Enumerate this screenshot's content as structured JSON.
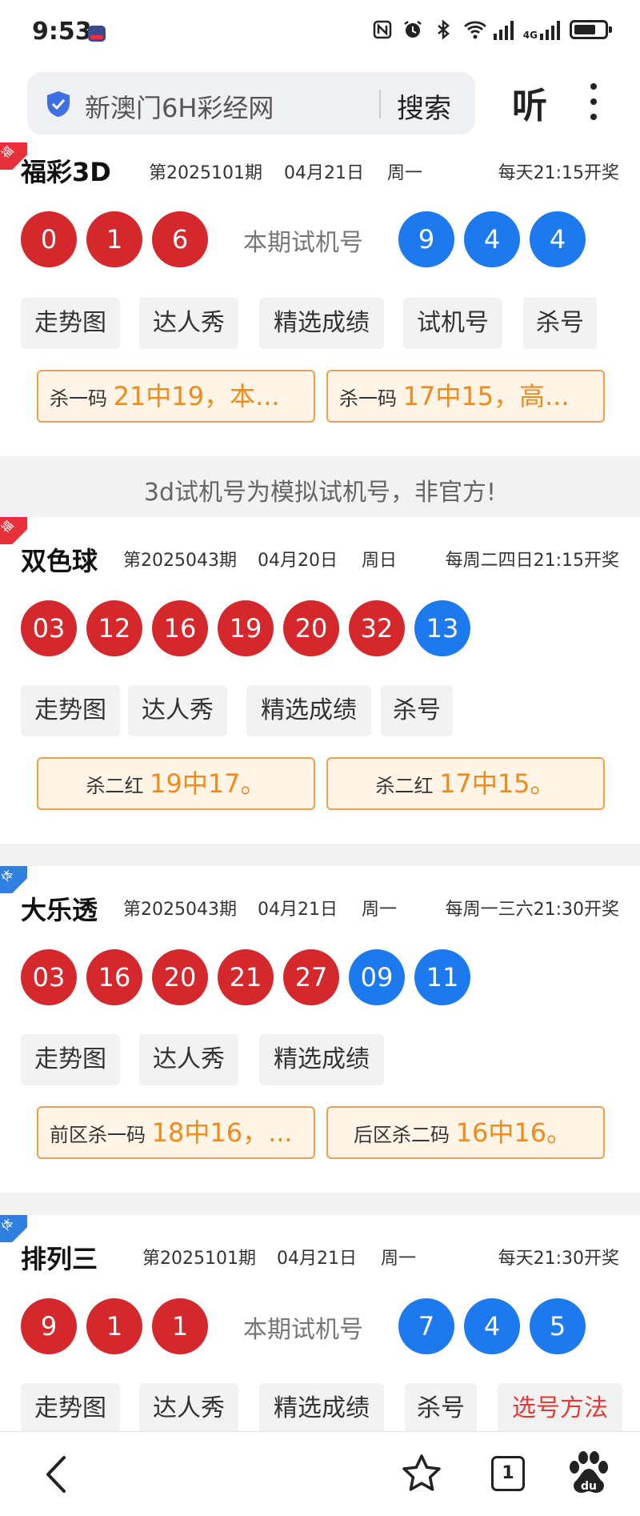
{
  "status": {
    "time": "9:53",
    "network": "4G"
  },
  "search": {
    "query": "新澳门6H彩经网",
    "button": "搜索",
    "listen": "听"
  },
  "cards": [
    {
      "tag": "福",
      "title": "福彩3D",
      "period": "第2025101期",
      "date": "04月21日",
      "weekday": "周一",
      "schedule": "每天21:15开奖",
      "balls": [
        "0",
        "1",
        "6"
      ],
      "trial_label": "本期试机号",
      "trial_balls": [
        "9",
        "4",
        "4"
      ],
      "tabs": [
        "走势图",
        "达人秀",
        "精选成绩",
        "试机号",
        "杀号"
      ],
      "kills": [
        {
          "label": "杀一码",
          "value": "21中19，本..."
        },
        {
          "label": "杀一码",
          "value": "17中15，高..."
        }
      ]
    },
    {
      "tag": "福",
      "title": "双色球",
      "period": "第2025043期",
      "date": "04月20日",
      "weekday": "周日",
      "schedule": "每周二四日21:15开奖",
      "red_balls": [
        "03",
        "12",
        "16",
        "19",
        "20",
        "32"
      ],
      "blue_balls": [
        "13"
      ],
      "tabs": [
        "走势图",
        "达人秀",
        "精选成绩",
        "杀号"
      ],
      "kills": [
        {
          "label": "杀二红",
          "value": "19中17。"
        },
        {
          "label": "杀二红",
          "value": "17中15。"
        }
      ]
    },
    {
      "tag": "体",
      "title": "大乐透",
      "period": "第2025043期",
      "date": "04月21日",
      "weekday": "周一",
      "schedule": "每周一三六21:30开奖",
      "red_balls": [
        "03",
        "16",
        "20",
        "21",
        "27"
      ],
      "blue_balls": [
        "09",
        "11"
      ],
      "tabs": [
        "走势图",
        "达人秀",
        "精选成绩"
      ],
      "kills": [
        {
          "label": "前区杀一码",
          "value": "18中16，..."
        },
        {
          "label": "后区杀二码",
          "value": "16中16。"
        }
      ]
    },
    {
      "tag": "体",
      "title": "排列三",
      "period": "第2025101期",
      "date": "04月21日",
      "weekday": "周一",
      "schedule": "每天21:30开奖",
      "balls": [
        "9",
        "1",
        "1"
      ],
      "trial_label": "本期试机号",
      "trial_balls": [
        "7",
        "4",
        "5"
      ],
      "tabs": [
        "走势图",
        "达人秀",
        "精选成绩",
        "杀号",
        "选号方法"
      ]
    }
  ],
  "notice": "3d试机号为模拟试机号，非官方!",
  "nav": {
    "tab_count": "1"
  },
  "colors": {
    "red_ball": "#d4282c",
    "blue_ball": "#1d79ee",
    "kill_accent": "#f08a1c",
    "highlight": "#e23a36"
  }
}
